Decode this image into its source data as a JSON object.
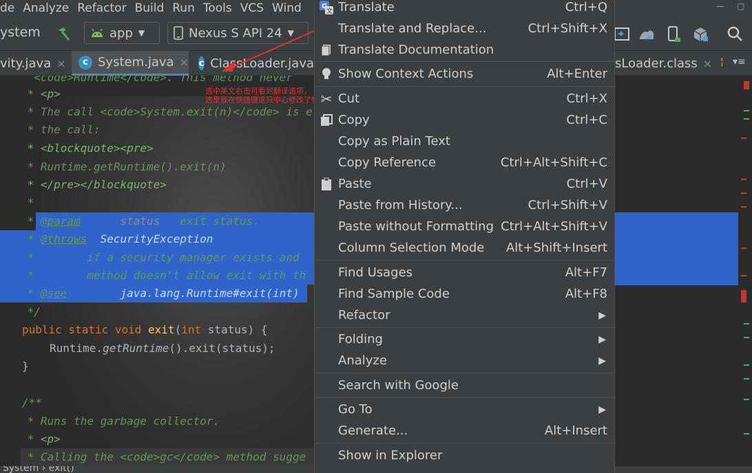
{
  "menubar": {
    "items": [
      "de",
      "Analyze",
      "Refactor",
      "Build",
      "Run",
      "Tools",
      "VCS",
      "Wind"
    ]
  },
  "toolbar": {
    "project_label": "ystem",
    "run_config": "app",
    "device": "Nexus S API 24"
  },
  "tabs": [
    {
      "label": "vity.java",
      "close": "×"
    },
    {
      "label": "System.java",
      "close": "×"
    },
    {
      "label": "ClassLoader.java",
      "close": ""
    },
    {
      "label": "sLoader.class",
      "close": "×"
    }
  ],
  "annotation": {
    "line1": "选中英文右击可看到翻译选项，",
    "line2": "这里我在快捷键这只中心修改了快捷键"
  },
  "code": {
    "l0": "  <code>Runtime</code>. This method never",
    "l1_star": " * ",
    "l1_tag": "<p>",
    "l2": " * The call <code>System.exit(n)</code> is e",
    "l3": " * the call:",
    "l4": " * <blockquote><pre>",
    "l5": " * Runtime.getRuntime().exit(n)",
    "l6": " * </pre></blockquote>",
    "l7": " *",
    "l8_star": " * ",
    "l8_tag": "@param",
    "l8_name": "status",
    "l8_desc": "exit status.",
    "l9_star": " * ",
    "l9_tag": "@throws",
    "l9_rest": "SecurityException",
    "l10": " *        if a security manager exists and",
    "l11": " *        method doesn't allow exit with th",
    "l12_star": " * ",
    "l12_tag": "@see",
    "l12_rest": "java.lang.Runtime#exit(int)",
    "l13": " */",
    "l14_kw": "public static void ",
    "l14_fn": "exit",
    "l14_p1": "(",
    "l14_kw2": "int",
    "l14_p2": " status) {",
    "l15_a": "Runtime.",
    "l15_it": "getRuntime",
    "l15_b": "().exit(status);",
    "l16": "}",
    "l17": "/**",
    "l18": " * Runs the garbage collector.",
    "l19_star": " * ",
    "l19_tag": "<p>",
    "l20": " * Calling the <code>gc</code> method sugge"
  },
  "status_bar": {
    "crumbs": "System  ›  exit()"
  },
  "context_menu": {
    "items": [
      {
        "label": "Translate",
        "shortcut": "Ctrl+Q",
        "icon": "translate-icon"
      },
      {
        "label": "Translate and Replace...",
        "shortcut": "Ctrl+Shift+X"
      },
      {
        "label": "Translate Documentation",
        "shortcut": "",
        "icon": "document-icon"
      },
      {
        "label": "Show Context Actions",
        "shortcut": "Alt+Enter",
        "icon": "lightbulb-icon"
      },
      {
        "label": "Cut",
        "shortcut": "Ctrl+X",
        "icon": "scissors-icon"
      },
      {
        "label": "Copy",
        "shortcut": "Ctrl+C",
        "icon": "copy-icon"
      },
      {
        "label": "Copy as Plain Text",
        "shortcut": ""
      },
      {
        "label": "Copy Reference",
        "shortcut": "Ctrl+Alt+Shift+C"
      },
      {
        "label": "Paste",
        "shortcut": "Ctrl+V",
        "icon": "clipboard-icon"
      },
      {
        "label": "Paste from History...",
        "shortcut": "Ctrl+Shift+V"
      },
      {
        "label": "Paste without Formatting",
        "shortcut": "Ctrl+Alt+Shift+V"
      },
      {
        "label": "Column Selection Mode",
        "shortcut": "Alt+Shift+Insert"
      },
      {
        "label": "Find Usages",
        "shortcut": "Alt+F7"
      },
      {
        "label": "Find Sample Code",
        "shortcut": "Alt+F8"
      },
      {
        "label": "Refactor",
        "shortcut": "",
        "submenu": true
      },
      {
        "label": "Folding",
        "shortcut": "",
        "submenu": true
      },
      {
        "label": "Analyze",
        "shortcut": "",
        "submenu": true
      },
      {
        "label": "Search with Google",
        "shortcut": ""
      },
      {
        "label": "Go To",
        "shortcut": "",
        "submenu": true
      },
      {
        "label": "Generate...",
        "shortcut": "Alt+Insert"
      },
      {
        "label": "Show in Explorer",
        "shortcut": ""
      }
    ],
    "submenu_arrow": "▶"
  },
  "colors": {
    "selection": "#2f65ca",
    "menu_bg": "#3c3f41",
    "annotation_red": "#e0322f"
  }
}
